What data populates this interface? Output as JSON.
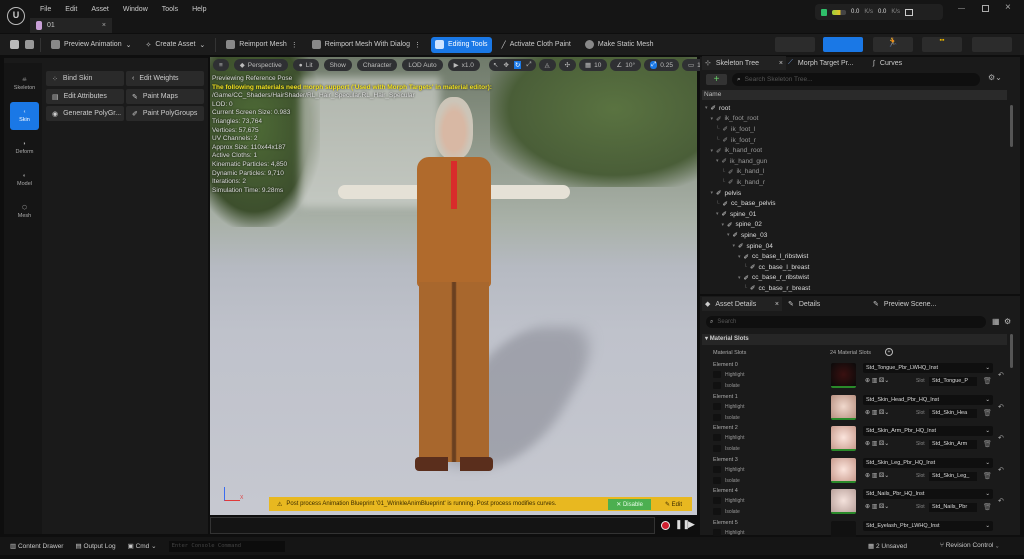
{
  "menu": [
    "File",
    "Edit",
    "Asset",
    "Window",
    "Tools",
    "Help"
  ],
  "doc_tab": "01",
  "status": {
    "up": "0.0",
    "down": "0.0",
    "unit": "K/s"
  },
  "toolbar": {
    "preview_animation": "Preview Animation",
    "create_asset": "Create Asset",
    "reimport_mesh": "Reimport Mesh",
    "reimport_dialog": "Reimport Mesh With Dialog",
    "editing_tools": "Editing Tools",
    "cloth_paint": "Activate Cloth Paint",
    "static_mesh": "Make Static Mesh"
  },
  "modes": [
    "Skeleton",
    "Skin",
    "Deform",
    "Model",
    "Mesh"
  ],
  "tools": [
    "Bind Skin",
    "Edit Weights",
    "Edit Attributes",
    "Paint Maps",
    "Generate PolyGr...",
    "Paint PolyGroups"
  ],
  "viewport": {
    "perspective": "Perspective",
    "lit": "Lit",
    "show": "Show",
    "character": "Character",
    "lod": "LOD Auto",
    "speed": "x1.0",
    "grid": "10",
    "angle": "10°",
    "scale": "0.25",
    "camera": "1",
    "info": [
      "Previewing Reference Pose"
    ],
    "warning": "The following materials need morph support ('Used with Morph Targets' in material editor):",
    "stats": [
      "/Game/CC_Shaders/HairShader/RL_Hair_Specular.RL_Hair_Specular",
      "LOD: 0",
      "Current Screen Size: 0.983",
      "Triangles: 73,764",
      "Vertices: 57,675",
      "UV Channels: 2",
      "Approx Size: 110x44x187",
      "Active Cloths: 1",
      "Kinematic Particles: 4,850",
      "Dynamic Particles: 9,710",
      "Iterations: 2",
      "Simulation Time: 9.28ms"
    ],
    "notice": "Post process Animation Blueprint '01_WrinkleAnimBlueprint' is running. Post process modifies curves.",
    "disable": "Disable",
    "edit": "Edit"
  },
  "right_tabs": {
    "skeleton_tree": "Skeleton Tree",
    "morph": "Morph Target Pr...",
    "curves": "Curves"
  },
  "search_placeholder": "Search Skeleton Tree...",
  "name_header": "Name",
  "bones": [
    {
      "n": "root",
      "d": 0
    },
    {
      "n": "ik_foot_root",
      "d": 1
    },
    {
      "n": "ik_foot_l",
      "d": 2
    },
    {
      "n": "ik_foot_r",
      "d": 2
    },
    {
      "n": "ik_hand_root",
      "d": 1
    },
    {
      "n": "ik_hand_gun",
      "d": 2
    },
    {
      "n": "ik_hand_l",
      "d": 3
    },
    {
      "n": "ik_hand_r",
      "d": 3
    },
    {
      "n": "pelvis",
      "d": 1
    },
    {
      "n": "cc_base_pelvis",
      "d": 2
    },
    {
      "n": "spine_01",
      "d": 2
    },
    {
      "n": "spine_02",
      "d": 3
    },
    {
      "n": "spine_03",
      "d": 4
    },
    {
      "n": "spine_04",
      "d": 5
    },
    {
      "n": "cc_base_l_ribstwist",
      "d": 6
    },
    {
      "n": "cc_base_l_breast",
      "d": 7
    },
    {
      "n": "cc_base_r_ribstwist",
      "d": 6
    },
    {
      "n": "cc_base_r_breast",
      "d": 7
    }
  ],
  "details_tabs": {
    "asset": "Asset Details",
    "details": "Details",
    "preview": "Preview Scene..."
  },
  "details_search": "Search",
  "material": {
    "section": "Material Slots",
    "label": "Material Slots",
    "count": "24 Material Slots",
    "highlight": "Highlight",
    "isolate": "Isolate",
    "slot": "Slot",
    "elements": [
      {
        "name": "Element 0",
        "mat": "Std_Tongue_Pbr_LWHQ_Inst",
        "slot": "Std_Tongue_P"
      },
      {
        "name": "Element 1",
        "mat": "Std_Skin_Head_Pbr_HQ_Inst",
        "slot": "Std_Skin_Hea"
      },
      {
        "name": "Element 2",
        "mat": "Std_Skin_Arm_Pbr_HQ_Inst",
        "slot": "Std_Skin_Arm"
      },
      {
        "name": "Element 3",
        "mat": "Std_Skin_Leg_Pbr_HQ_Inst",
        "slot": "Std_Skin_Leg_"
      },
      {
        "name": "Element 4",
        "mat": "Std_Nails_Pbr_HQ_Inst",
        "slot": "Std_Nails_Pbr"
      },
      {
        "name": "Element 5",
        "mat": "Std_Eyelash_Pbr_LWHQ_Inst",
        "slot": ""
      }
    ]
  },
  "bottom": {
    "content_drawer": "Content Drawer",
    "output_log": "Output Log",
    "cmd": "Cmd",
    "console_placeholder": "Enter Console Command",
    "unsaved": "2 Unsaved",
    "revision": "Revision Control"
  },
  "colors": {
    "accent": "#1a78e6",
    "warning": "#e6b400",
    "notice": "#e8b820",
    "disable": "#4caf50"
  }
}
